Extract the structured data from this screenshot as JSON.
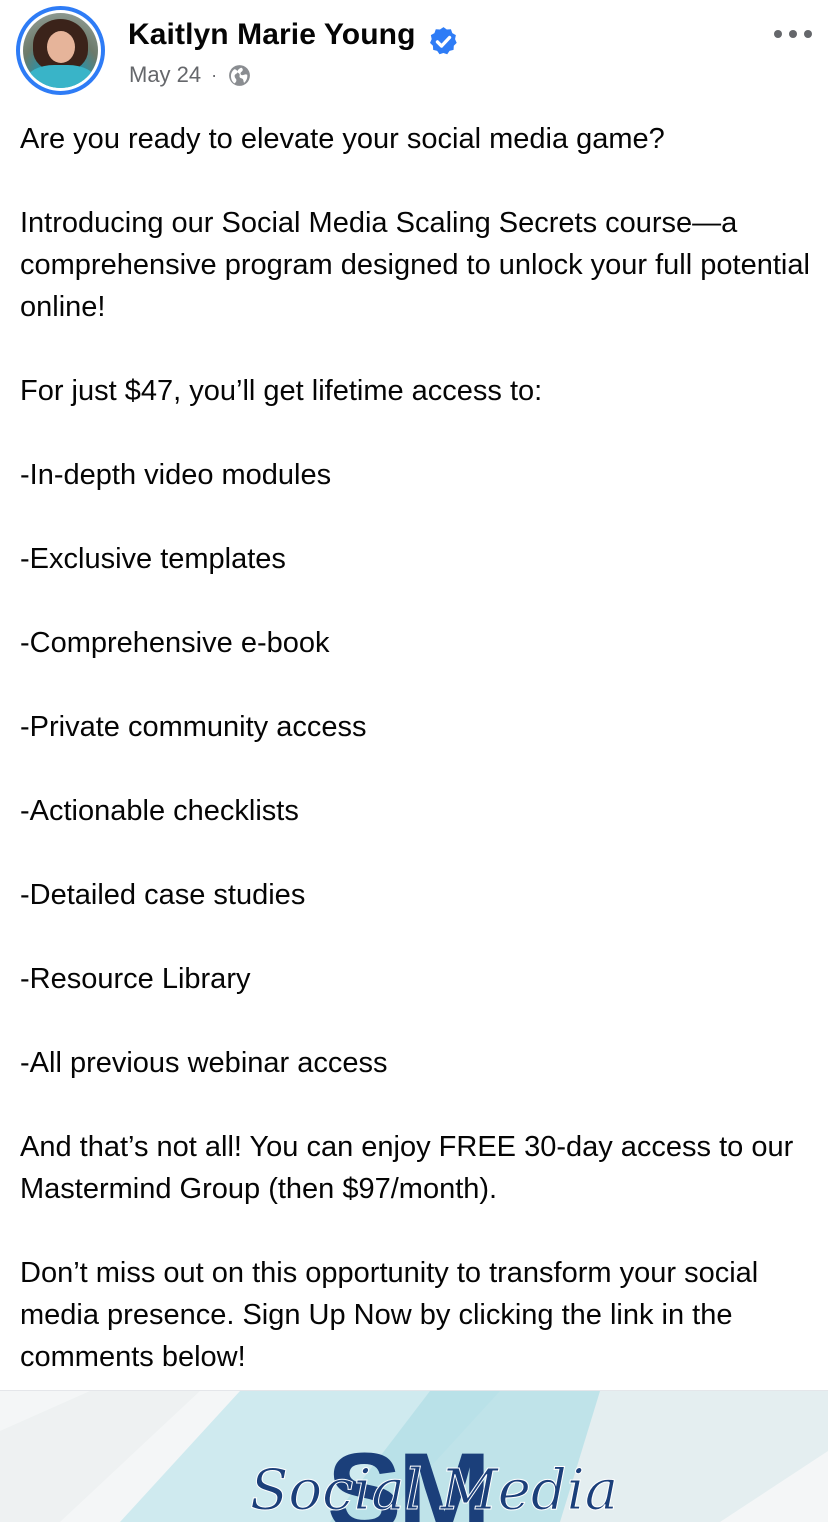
{
  "post": {
    "author": "Kaitlyn Marie Young",
    "verified": true,
    "date": "May 24",
    "separator": "·",
    "audience_icon": "globe-icon",
    "menu_icon": "more-options-icon",
    "accent_color": "#2e7cf6",
    "text_color": "#050505",
    "meta_color": "#65676b",
    "paragraphs": [
      "Are you ready to elevate your social media game?",
      "Introducing our Social Media Scaling Secrets course—a comprehensive program designed to unlock your full potential online!",
      "For just $47, you’ll get lifetime access to:",
      "-In-depth video modules",
      "-Exclusive templates",
      "-Comprehensive e-book",
      "-Private community access",
      "-Actionable checklists",
      "-Detailed case studies",
      "-Resource Library",
      "-All previous webinar access",
      "And that’s not all! You can enjoy FREE 30-day access to our Mastermind Group (then $97/month).",
      "Don’t miss out on this opportunity to transform your social media presence. Sign Up Now by clicking the link in the comments below!"
    ]
  },
  "image": {
    "logo_letters": "SM",
    "logo_script": "Social Media",
    "logo_color": "#1b3f7a",
    "bg_accent": "#bfe6ec"
  }
}
